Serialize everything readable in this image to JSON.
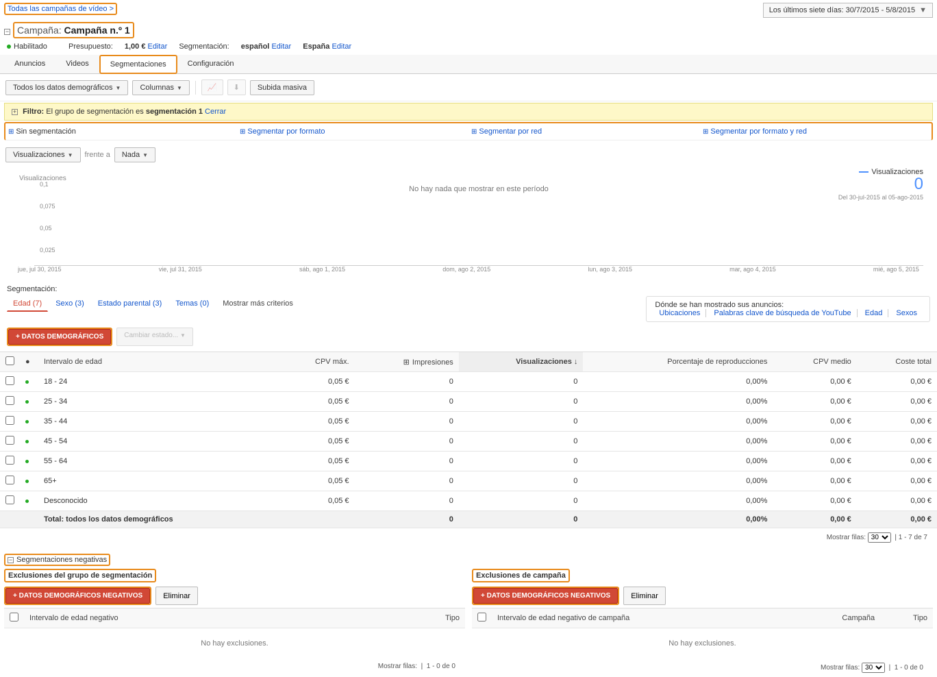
{
  "breadcrumb": "Todas las campañas de vídeo >",
  "daterange": "Los últimos siete días: 30/7/2015 - 5/8/2015",
  "campaign": {
    "label": "Campaña:",
    "name": "Campaña n.º 1"
  },
  "meta": {
    "status": "Habilitado",
    "budget_label": "Presupuesto:",
    "budget_val": "1,00 €",
    "edit": "Editar",
    "segmentation_label": "Segmentación:",
    "segmentation_val": "español",
    "country": "España"
  },
  "tabs": {
    "anuncios": "Anuncios",
    "videos": "Videos",
    "segmentaciones": "Segmentaciones",
    "configuracion": "Configuración"
  },
  "toolbar": {
    "dd1": "Todos los datos demográficos",
    "dd2": "Columnas",
    "bulk": "Subida masiva"
  },
  "filter": {
    "label": "Filtro:",
    "text": "El grupo de segmentación es ",
    "bold": "segmentación 1",
    "close": "Cerrar"
  },
  "segments": {
    "none": "Sin segmentación",
    "format": "Segmentar por formato",
    "red": "Segmentar por red",
    "both": "Segmentar por formato y red"
  },
  "chart_controls": {
    "metric": "Visualizaciones",
    "vs": "frente a",
    "none": "Nada"
  },
  "chart": {
    "ylabels": [
      "0,1",
      "0,075",
      "0,05",
      "0,025"
    ],
    "xlabels": [
      "jue, jul 30, 2015",
      "vie, jul 31, 2015",
      "sáb, ago 1, 2015",
      "dom, ago 2, 2015",
      "lun, ago 3, 2015",
      "mar, ago 4, 2015",
      "mié, ago 5, 2015"
    ],
    "title": "Visualizaciones",
    "empty": "No hay nada que mostrar en este período",
    "legend": "Visualizaciones",
    "big": "0",
    "dates": "Del 30-jul-2015 al 05-ago-2015"
  },
  "segm_label": "Segmentación:",
  "criteria": {
    "edad": "Edad (7)",
    "sexo": "Sexo (3)",
    "parental": "Estado parental (3)",
    "temas": "Temas (0)",
    "more": "Mostrar más criterios"
  },
  "shown": {
    "title": "Dónde se han mostrado sus anuncios:",
    "ubic": "Ubicaciones",
    "yt": "Palabras clave de búsqueda de YouTube",
    "edad": "Edad",
    "sexos": "Sexos"
  },
  "actions": {
    "add": "+  DATOS DEMOGRÁFICOS",
    "change": "Cambiar estado..."
  },
  "table": {
    "headers": {
      "range": "Intervalo de edad",
      "cpvmax": "CPV máx.",
      "impr": "Impresiones",
      "views": "Visualizaciones",
      "pct": "Porcentaje de reproducciones",
      "cpv": "CPV medio",
      "cost": "Coste total"
    },
    "rows": [
      {
        "range": "18 - 24",
        "cpvmax": "0,05 €",
        "impr": "0",
        "views": "0",
        "pct": "0,00%",
        "cpv": "0,00 €",
        "cost": "0,00 €"
      },
      {
        "range": "25 - 34",
        "cpvmax": "0,05 €",
        "impr": "0",
        "views": "0",
        "pct": "0,00%",
        "cpv": "0,00 €",
        "cost": "0,00 €"
      },
      {
        "range": "35 - 44",
        "cpvmax": "0,05 €",
        "impr": "0",
        "views": "0",
        "pct": "0,00%",
        "cpv": "0,00 €",
        "cost": "0,00 €"
      },
      {
        "range": "45 - 54",
        "cpvmax": "0,05 €",
        "impr": "0",
        "views": "0",
        "pct": "0,00%",
        "cpv": "0,00 €",
        "cost": "0,00 €"
      },
      {
        "range": "55 - 64",
        "cpvmax": "0,05 €",
        "impr": "0",
        "views": "0",
        "pct": "0,00%",
        "cpv": "0,00 €",
        "cost": "0,00 €"
      },
      {
        "range": "65+",
        "cpvmax": "0,05 €",
        "impr": "0",
        "views": "0",
        "pct": "0,00%",
        "cpv": "0,00 €",
        "cost": "0,00 €"
      },
      {
        "range": "Desconocido",
        "cpvmax": "0,05 €",
        "impr": "0",
        "views": "0",
        "pct": "0,00%",
        "cpv": "0,00 €",
        "cost": "0,00 €"
      }
    ],
    "total": {
      "label": "Total: todos los datos demográficos",
      "impr": "0",
      "views": "0",
      "pct": "0,00%",
      "cpv": "0,00 €",
      "cost": "0,00 €"
    }
  },
  "pager": {
    "label": "Mostrar filas:",
    "size": "30",
    "range": "1 - 7 de 7"
  },
  "neg_title": "Segmentaciones negativas",
  "excl": {
    "group_title": "Exclusiones del grupo de segmentación",
    "camp_title": "Exclusiones de campaña",
    "add_neg": "+  DATOS DEMOGRÁFICOS NEGATIVOS",
    "delete": "Eliminar",
    "col_range": "Intervalo de edad negativo",
    "col_range_camp": "Intervalo de edad negativo de campaña",
    "col_type": "Tipo",
    "col_camp": "Campaña",
    "none": "No hay exclusiones.",
    "pager_range": "1 - 0 de 0"
  }
}
